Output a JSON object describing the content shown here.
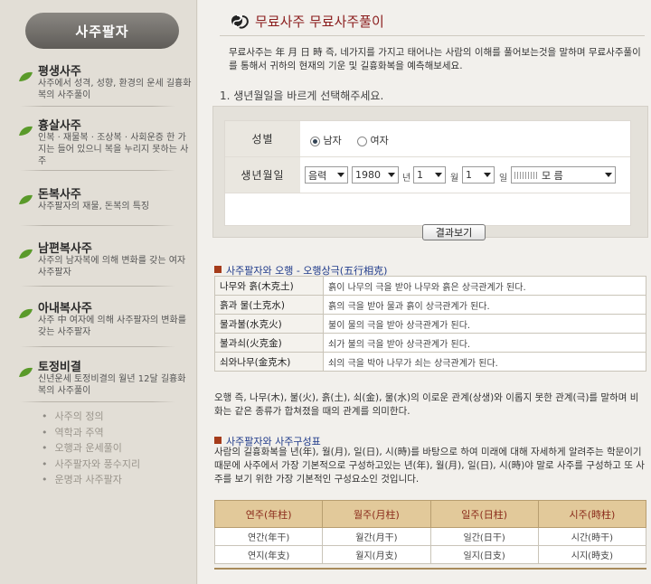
{
  "sidebar": {
    "title": "사주팔자",
    "items": [
      {
        "title": "평생사주",
        "desc": "사주에서 성격, 성향, 환경의 운세 길흉화복의 사주풀이"
      },
      {
        "title": "흉살사주",
        "desc": "인복 · 재물복 · 조상복 · 사회운증 한 가지는 들어 있으니 복을 누리지 못하는 사주"
      },
      {
        "title": "돈복사주",
        "desc": "사주팔자의 재물, 돈복의 특징"
      },
      {
        "title": "남편복사주",
        "desc": "사주의 남자복에 의해 변화를 갖는 여자사주팔자"
      },
      {
        "title": "아내복사주",
        "desc": "사주 中 여자에 의해 사주팔자의 변화를 갖는 사주팔자"
      },
      {
        "title": "토정비결",
        "desc": "신년운세 토정비결의 월년 12달 길흉화복의 사주풀이"
      }
    ],
    "links": [
      "사주의 정의",
      "역학과 주역",
      "오행과 운세풀이",
      "사주팔자와 풍수지리",
      "운명과 사주팔자"
    ]
  },
  "main": {
    "title": "무료사주 무료사주풀이",
    "intro": "무료사주는 年 月 日 時 즉, 네가지를 가지고 태어나는 사람의 이해를 풀어보는것을 말하며 무료사주풀이를 통해서 귀하의 현재의 기운 및 길흉화복을 예측해보세요.",
    "step": "1. 생년월일을 바르게 선택해주세요.",
    "form": {
      "gender_label": "성별",
      "male": "남자",
      "female": "여자",
      "gender_selected": "male",
      "birth_label": "생년월일",
      "calendar": "음력",
      "year": "1980",
      "year_unit": "년",
      "month": "1",
      "month_unit": "월",
      "day": "1",
      "day_unit": "일",
      "time": "모 름",
      "submit": "결과보기"
    },
    "oheng": {
      "heading": "사주팔자와 오행 - 오행상극(五行相克)",
      "rows": [
        {
          "k": "나무와 흙(木克土)",
          "v": "흙이 나무의 극을 받아 나무와 흙은 상극관계가 된다."
        },
        {
          "k": "흙과 물(土克水)",
          "v": "흙의 극을 받아 물과 흙이 상극관계가 된다."
        },
        {
          "k": "물과불(水克火)",
          "v": "불이 물의 극을 받아 상극관계가 된다."
        },
        {
          "k": "불과쇠(火克金)",
          "v": "쇠가 불의 극을 받아 상극관계가 된다."
        },
        {
          "k": "쇠와나무(金克木)",
          "v": "쇠의 극을 박아 나무가 쇠는 상극관계가 된다."
        }
      ],
      "note": "오행 즉, 나무(木), 불(火), 흙(土), 쇠(金), 물(水)의 이로운 관계(상생)와 이롭지 못한 관계(극)를 말하며 비화는 같은 종류가 합쳐졌을 때의 관계를 의미한다."
    },
    "composition": {
      "heading": "사주팔자와 사주구성표",
      "text": "사람의 길흉화복을 년(年), 월(月), 일(日), 시(時)를 바탕으로 하여 미래에 대해 자세하게 알려주는 학문이기 때문에 사주에서 가장 기본적으로 구성하고있는 년(年), 월(月), 일(日), 시(時)야 말로 사주를 구성하고 또 사주를 보기 위한 가장 기본적인 구성요소인 것입니다.",
      "headers": [
        "연주(年柱)",
        "월주(月柱)",
        "일주(日柱)",
        "시주(時柱)"
      ],
      "rows": [
        [
          "연간(年干)",
          "월간(月干)",
          "일간(日干)",
          "시간(時干)"
        ],
        [
          "연지(年支)",
          "월지(月支)",
          "일지(日支)",
          "시지(時支)"
        ]
      ]
    }
  },
  "icons": {
    "sidebar_bullet": "leaf-icon",
    "title_logo": "swirl-logo-icon",
    "section_bullet": "square-bullet-icon"
  },
  "colors": {
    "title": "#8a1c1c",
    "section_head": "#1f3a8a",
    "table_header": "#e2c99a",
    "leaf": "#5a9a2a"
  }
}
